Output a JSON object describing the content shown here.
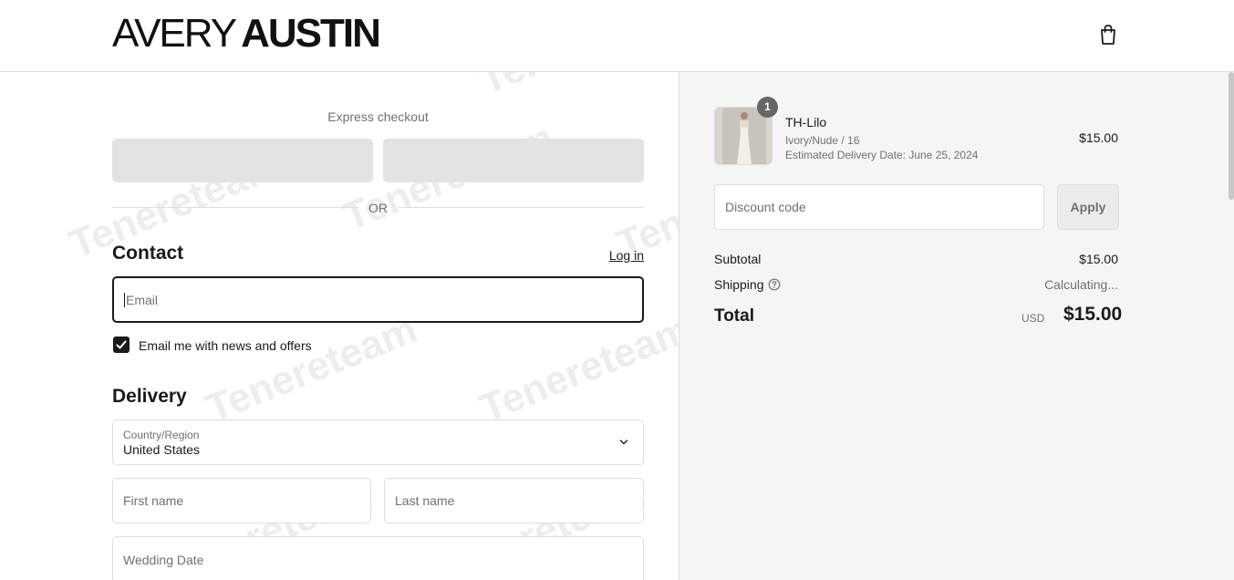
{
  "header": {
    "logo_thin": "AVERY",
    "logo_bold": "AUSTIN",
    "cart_icon": "shopping-bag-icon"
  },
  "express": {
    "title": "Express checkout",
    "or_label": "OR"
  },
  "contact": {
    "title": "Contact",
    "login_label": "Log in",
    "email_placeholder": "Email",
    "newsletter_label": "Email me with news and offers",
    "newsletter_checked": true
  },
  "delivery": {
    "title": "Delivery",
    "country_label": "Country/Region",
    "country_value": "United States",
    "first_name_placeholder": "First name",
    "last_name_placeholder": "Last name",
    "wedding_date_placeholder": "Wedding Date"
  },
  "summary": {
    "item": {
      "quantity": "1",
      "name": "TH-Lilo",
      "variant": "Ivory/Nude / 16",
      "delivery": "Estimated Delivery Date: June 25, 2024",
      "price": "$15.00"
    },
    "discount_placeholder": "Discount code",
    "apply_label": "Apply",
    "subtotal_label": "Subtotal",
    "subtotal_value": "$15.00",
    "shipping_label": "Shipping",
    "shipping_value": "Calculating...",
    "total_label": "Total",
    "total_currency": "USD",
    "total_value": "$15.00"
  },
  "watermark": "Tenereteam",
  "colors": {
    "text": "#1a1a1a",
    "muted": "#707070",
    "border": "#dedede",
    "summary_bg": "#f5f5f5"
  }
}
